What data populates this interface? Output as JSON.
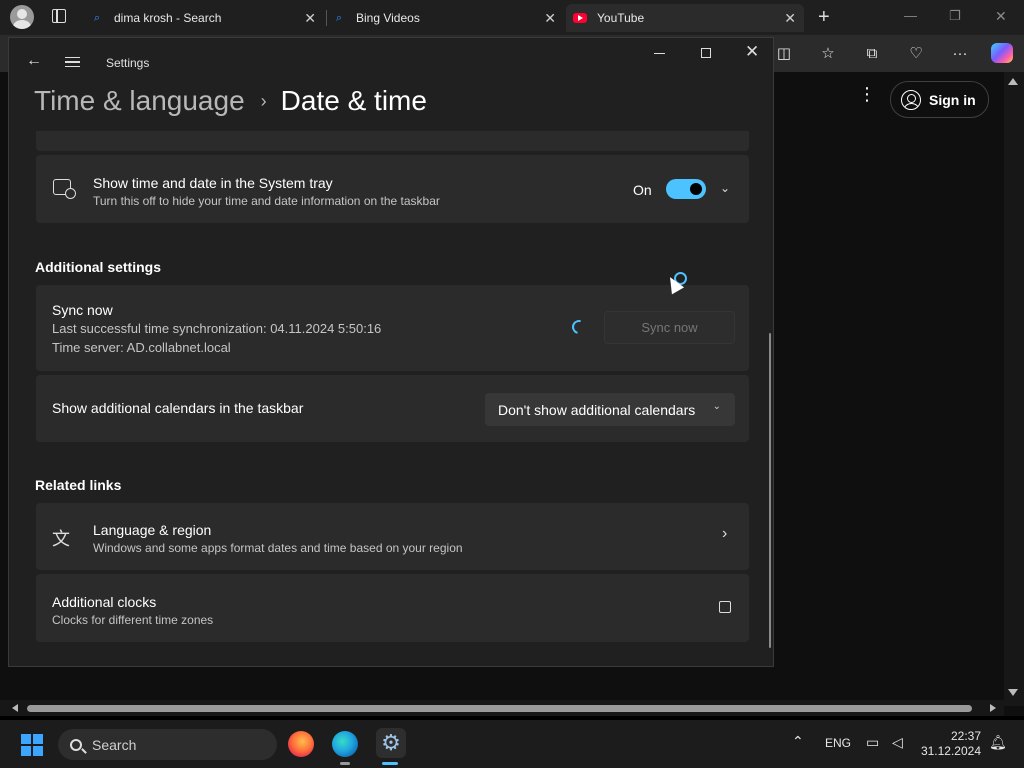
{
  "browser": {
    "tabs": [
      {
        "label": "dima krosh - Search",
        "favicon": "search-icon"
      },
      {
        "label": "Bing Videos",
        "favicon": "search-icon"
      },
      {
        "label": "YouTube",
        "favicon": "youtube-icon"
      }
    ],
    "new_tab": "+",
    "page": {
      "signin_label": "Sign in"
    }
  },
  "settings": {
    "app_title": "Settings",
    "breadcrumb": {
      "parent": "Time & language",
      "separator": "›",
      "current": "Date & time"
    },
    "tray_card": {
      "title": "Show time and date in the System tray",
      "subtitle": "Turn this off to hide your time and date information on the taskbar",
      "toggle_label": "On",
      "toggle_on": true
    },
    "additional_settings": {
      "heading": "Additional settings",
      "sync": {
        "title": "Sync now",
        "last_sync": "Last successful time synchronization: 04.11.2024 5:50:16",
        "server": "Time server: AD.collabnet.local",
        "button_label": "Sync now"
      },
      "calendars": {
        "title": "Show additional calendars in the taskbar",
        "selected": "Don't show additional calendars"
      }
    },
    "related_links": {
      "heading": "Related links",
      "language_region": {
        "title": "Language & region",
        "subtitle": "Windows and some apps format dates and time based on your region"
      },
      "additional_clocks": {
        "title": "Additional clocks",
        "subtitle": "Clocks for different time zones"
      }
    }
  },
  "taskbar": {
    "search_placeholder": "Search",
    "language": "ENG",
    "time": "22:37",
    "date": "31.12.2024"
  },
  "colors": {
    "accent": "#4cc2ff",
    "settings_bg": "#202020",
    "card_bg": "#2b2b2b"
  }
}
